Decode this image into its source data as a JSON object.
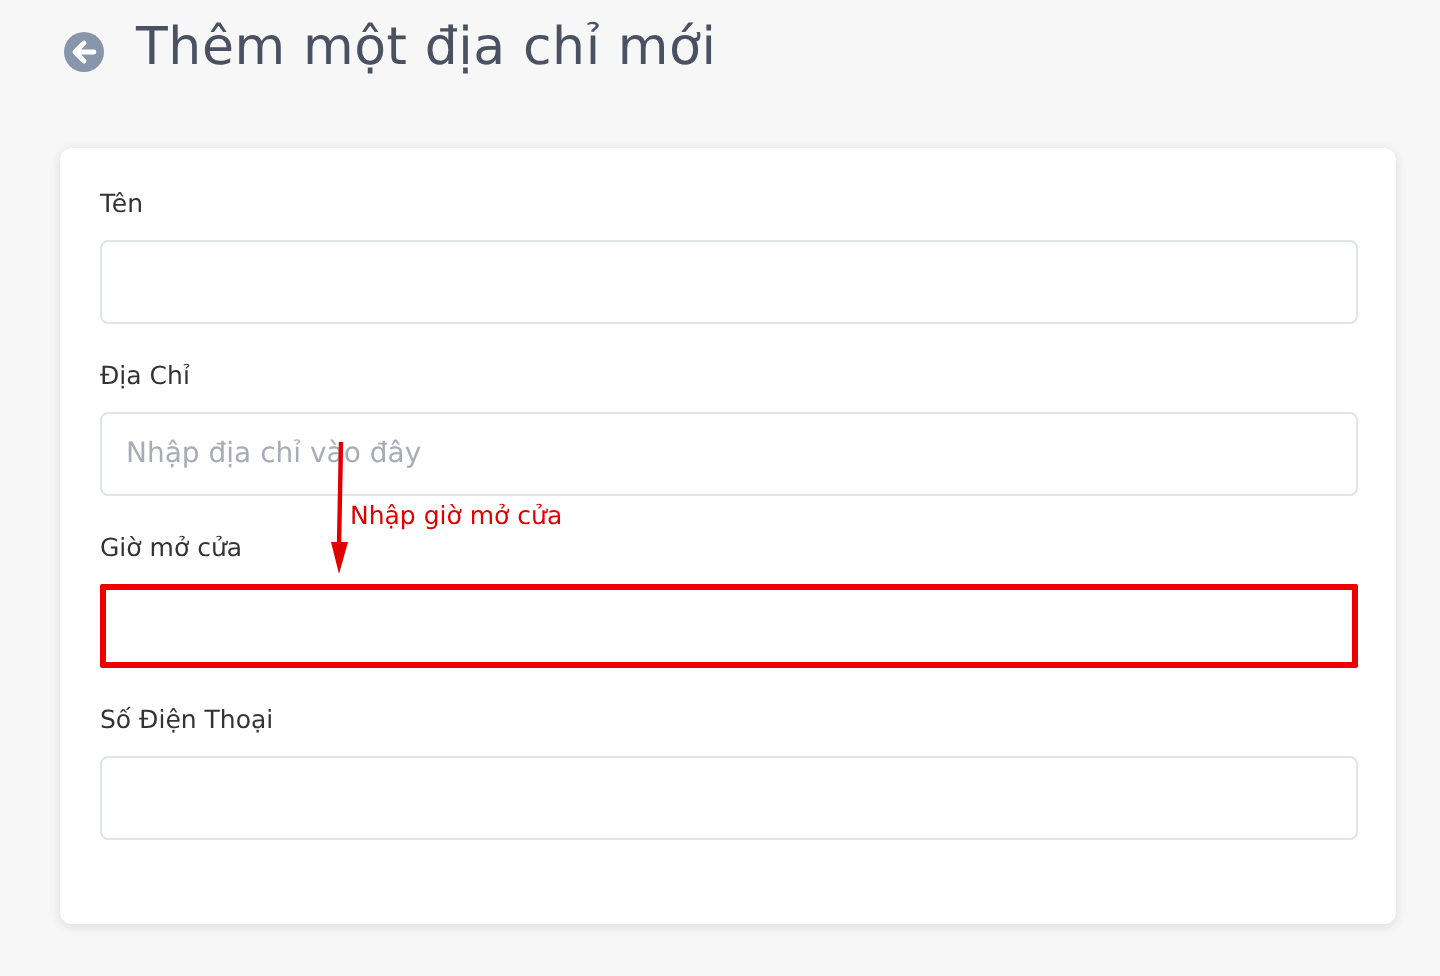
{
  "header": {
    "title": "Thêm một địa chỉ mới"
  },
  "form": {
    "fields": [
      {
        "label": "Tên",
        "highlighted": false
      },
      {
        "label": "Địa Chỉ",
        "placeholder": "Nhập địa chỉ vào đây",
        "highlighted": false
      },
      {
        "label": "Giờ mở cửa",
        "highlighted": true,
        "annotation": "Nhập giờ mở cửa"
      },
      {
        "label": "Số Điện Thoại",
        "highlighted": false
      }
    ]
  }
}
